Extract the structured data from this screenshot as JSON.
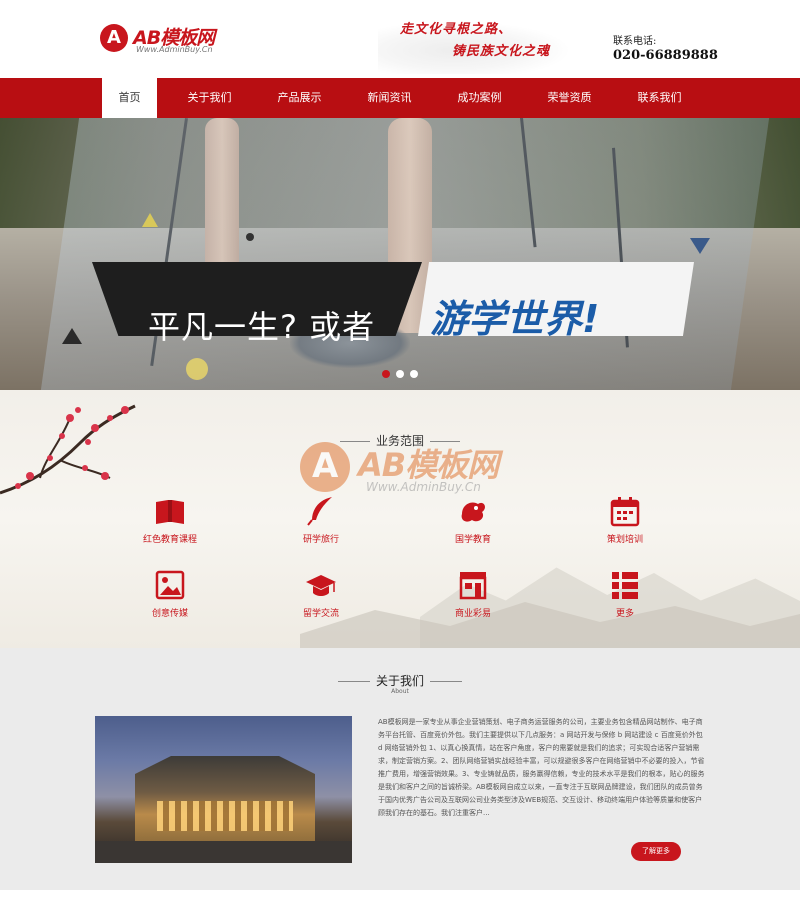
{
  "header": {
    "logo_name": "AB模板网",
    "logo_url": "Www.AdminBuy.Cn",
    "slogan_line1": "走文化寻根之路、",
    "slogan_line2": "铸民族文化之魂",
    "hotline_label": "联系电话:",
    "hotline_number": "020-66889888"
  },
  "nav": {
    "items": [
      {
        "label": "首页",
        "active": true
      },
      {
        "label": "关于我们"
      },
      {
        "label": "产品展示"
      },
      {
        "label": "新闻资讯"
      },
      {
        "label": "成功案例"
      },
      {
        "label": "荣誉资质"
      },
      {
        "label": "联系我们"
      }
    ]
  },
  "banner": {
    "text_dark": "平凡一生? 或者",
    "text_light": "游学世界!",
    "slide_count": 3,
    "active_slide": 1
  },
  "services": {
    "title": "业务范围",
    "watermark_name": "AB模板网",
    "watermark_url": "Www.AdminBuy.Cn",
    "items": [
      {
        "label": "红色教育课程",
        "icon": "book-icon"
      },
      {
        "label": "研学旅行",
        "icon": "feather-icon"
      },
      {
        "label": "国学教育",
        "icon": "dragon-icon"
      },
      {
        "label": "策划培训",
        "icon": "calendar-icon"
      },
      {
        "label": "创意传媒",
        "icon": "image-icon"
      },
      {
        "label": "留学交流",
        "icon": "graduation-cap-icon"
      },
      {
        "label": "商业彩易",
        "icon": "storefront-icon"
      },
      {
        "label": "更多",
        "icon": "list-icon"
      }
    ],
    "accent_color": "#c8161d"
  },
  "about": {
    "title": "关于我们",
    "subtitle": "About",
    "body": "AB模板网是一家专业从事企业营销策划、电子商务运营服务的公司，主要业务包含精品网站制作、电子商务平台托管、百度竞价外包。我们主要提供以下几点服务：a 网站开发与保修 b 网站建设 c 百度竞价外包 d 网络营销外包 1、以真心换真情，站在客户角度，客户的需要就是我们的追求；可实现合适客户营销需求，制定营销方案。2、团队网络营销实战经验丰富，可以规避很多客户在网络营销中不必要的投入，节省推广费用，增强营销效果。3、专业铸就品质，服务赢得信赖，专业的技术水平是我们的根本，贴心的服务是我们和客户之间的旨诚桥梁。AB模板网自成立以来，一直专注于互联网品牌建设，我们团队的成员曾务于国内优秀广告公司及互联网公司业务类型涉及WEB规范、交互设计、移动终端用户体验等质量和使客户顾我们存在的基石。我们注重客户...",
    "more_label": "了解更多"
  },
  "colors": {
    "brand_red": "#c8161d",
    "nav_red": "#b80e12",
    "banner_blue": "#1b5ca8"
  }
}
